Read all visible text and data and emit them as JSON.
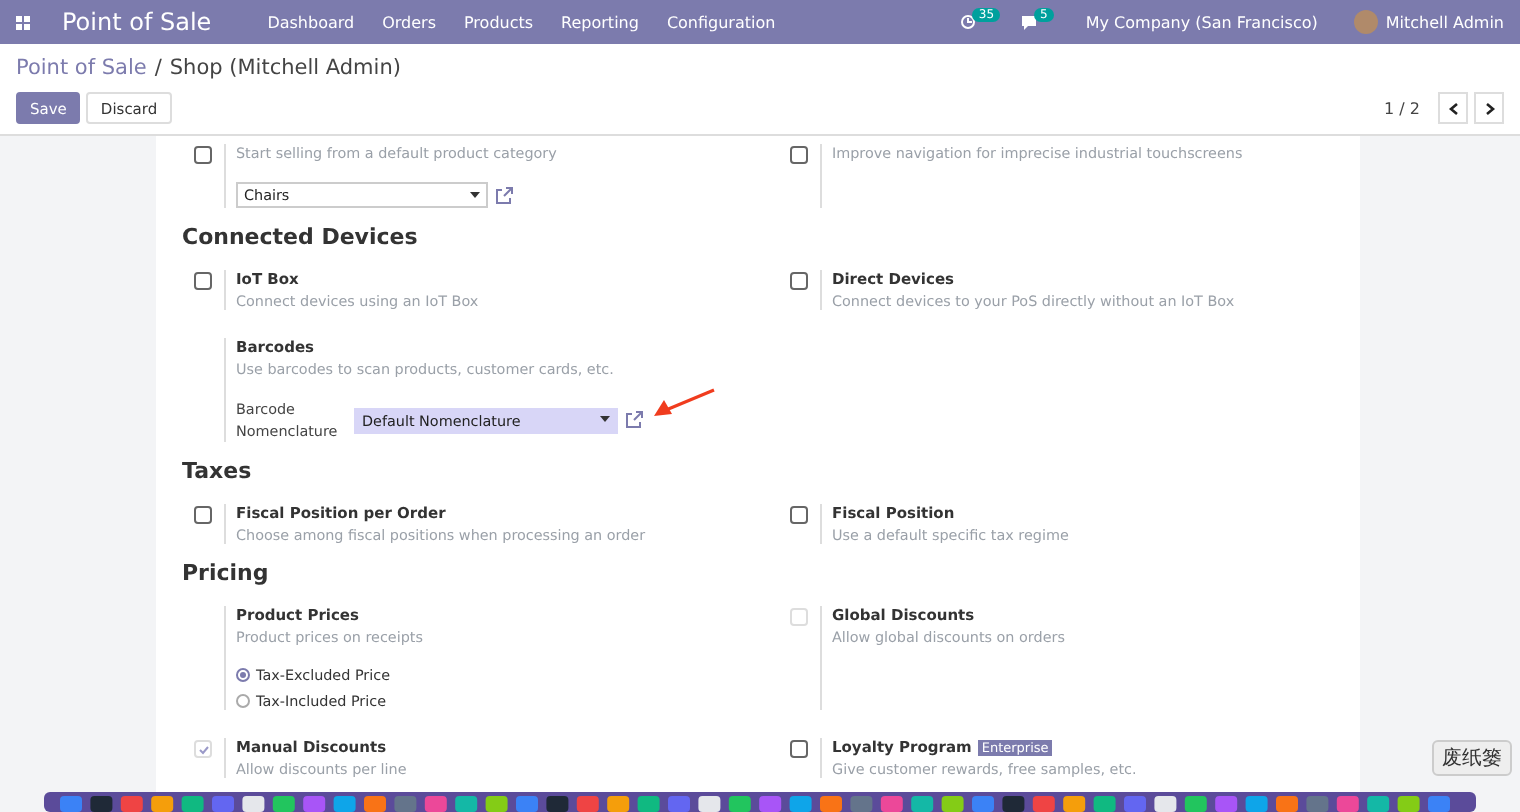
{
  "navbar": {
    "app_name": "Point of Sale",
    "menu": [
      "Dashboard",
      "Orders",
      "Products",
      "Reporting",
      "Configuration"
    ],
    "activity_count": "35",
    "message_count": "5",
    "company": "My Company (San Francisco)",
    "user": "Mitchell Admin"
  },
  "breadcrumb": {
    "parent": "Point of Sale",
    "separator": "/",
    "current": "Shop (Mitchell Admin)"
  },
  "buttons": [
    {
      "label": "Save",
      "kind": "primary"
    },
    {
      "label": "Discard",
      "kind": "secondary"
    }
  ],
  "pager": "1 / 2",
  "sections": [
    {
      "settings": [
        {
          "kind": "checkbox",
          "checked": false,
          "disabled": false,
          "description": "Start selling from a default product category",
          "select": {
            "value": "Chairs",
            "highlighted": false
          }
        },
        {
          "kind": "checkbox",
          "checked": false,
          "disabled": false,
          "description": "Improve navigation for imprecise industrial touchscreens"
        }
      ]
    },
    {
      "title": "Connected Devices",
      "settings": [
        {
          "kind": "checkbox",
          "checked": false,
          "disabled": false,
          "title": "IoT Box",
          "description": "Connect devices using an IoT Box"
        },
        {
          "kind": "checkbox",
          "checked": false,
          "disabled": false,
          "title": "Direct Devices",
          "description": "Connect devices to your PoS directly without an IoT Box"
        },
        {
          "kind": "plain",
          "title": "Barcodes",
          "description": "Use barcodes to scan products, customer cards, etc.",
          "field_label": "Barcode Nomenclature",
          "select": {
            "value": "Default Nomenclature",
            "highlighted": true
          }
        }
      ]
    },
    {
      "title": "Taxes",
      "settings": [
        {
          "kind": "checkbox",
          "checked": false,
          "disabled": false,
          "title": "Fiscal Position per Order",
          "description": "Choose among fiscal positions when processing an order"
        },
        {
          "kind": "checkbox",
          "checked": false,
          "disabled": false,
          "title": "Fiscal Position",
          "description": "Use a default specific tax regime"
        }
      ]
    },
    {
      "title": "Pricing",
      "settings": [
        {
          "kind": "plain",
          "title": "Product Prices",
          "description": "Product prices on receipts",
          "radios": [
            {
              "label": "Tax-Excluded Price",
              "selected": true
            },
            {
              "label": "Tax-Included Price",
              "selected": false
            }
          ]
        },
        {
          "kind": "checkbox",
          "checked": false,
          "disabled": true,
          "title": "Global Discounts",
          "description": "Allow global discounts on orders"
        },
        {
          "kind": "checkbox",
          "checked": true,
          "disabled": true,
          "title": "Manual Discounts",
          "description": "Allow discounts per line"
        },
        {
          "kind": "checkbox",
          "checked": false,
          "disabled": false,
          "title": "Loyalty Program",
          "badge": "Enterprise",
          "description": "Give customer rewards, free samples, etc."
        }
      ]
    }
  ],
  "dock_tooltip": "废纸篓"
}
